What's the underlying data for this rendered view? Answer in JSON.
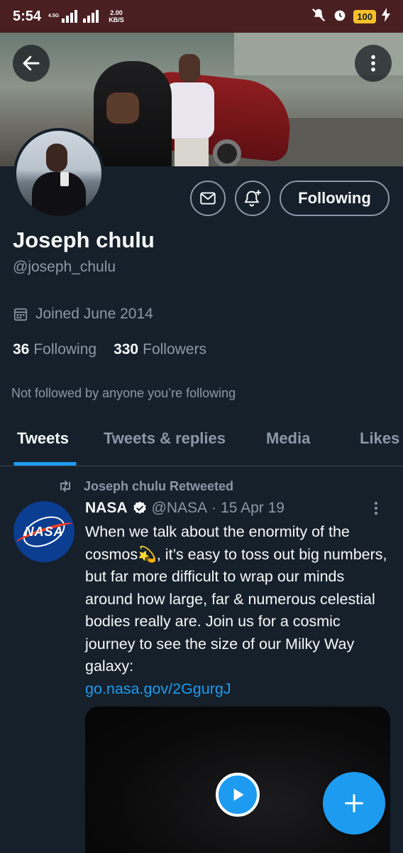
{
  "status_bar": {
    "time": "5:54",
    "network_tag": "4.5G",
    "speed_value": "2.00",
    "speed_unit": "KB/S",
    "battery": "100"
  },
  "header": {
    "back_icon": "arrow-left-icon",
    "more_icon": "more-vertical-icon"
  },
  "profile": {
    "display_name": "Joseph chulu",
    "handle": "@joseph_chulu",
    "joined": "Joined June 2014",
    "following_count": "36",
    "following_label": "Following",
    "followers_count": "330",
    "followers_label": "Followers",
    "not_followed_text": "Not followed by anyone you’re following",
    "follow_button_label": "Following"
  },
  "tabs": [
    {
      "label": "Tweets",
      "active": true
    },
    {
      "label": "Tweets & replies",
      "active": false
    },
    {
      "label": "Media",
      "active": false
    },
    {
      "label": "Likes",
      "active": false
    }
  ],
  "tweet": {
    "retweet_label": "Joseph chulu Retweeted",
    "author_name": "NASA",
    "author_handle": "@NASA",
    "separator": "·",
    "date": "15 Apr 19",
    "avatar_text": "NASA",
    "body": "When we talk about the enormity of the cosmos💫, it’s easy to toss out big numbers, but far more difficult to wrap our minds around how large, far & numerous celestial bodies really are. Join us for a cosmic journey to see the size of our Milky Way galaxy:",
    "link": "go.nasa.gov/2GgurgJ"
  },
  "colors": {
    "background": "#15202b",
    "accent": "#1d9bf0",
    "muted_text": "#8b98a5",
    "status_bar": "#4a1f22"
  }
}
